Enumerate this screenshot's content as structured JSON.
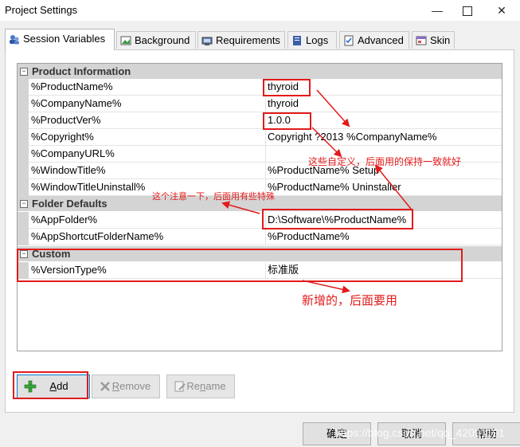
{
  "window": {
    "title": "Project Settings"
  },
  "tabs": [
    {
      "label": "Session Variables",
      "icon": "variables-icon"
    },
    {
      "label": "Background",
      "icon": "background-icon"
    },
    {
      "label": "Requirements",
      "icon": "requirements-icon"
    },
    {
      "label": "Logs",
      "icon": "logs-icon"
    },
    {
      "label": "Advanced",
      "icon": "advanced-icon"
    },
    {
      "label": "Skin",
      "icon": "skin-icon"
    }
  ],
  "grid": {
    "categories": [
      {
        "label": "Product Information",
        "toggle": "−",
        "rows": [
          {
            "name": "%ProductName%",
            "value": "thyroid"
          },
          {
            "name": "%CompanyName%",
            "value": "thyroid"
          },
          {
            "name": "%ProductVer%",
            "value": "1.0.0"
          },
          {
            "name": "%Copyright%",
            "value": "Copyright ?2013 %CompanyName%"
          },
          {
            "name": "%CompanyURL%",
            "value": ""
          },
          {
            "name": "%WindowTitle%",
            "value": "%ProductName% Setup"
          },
          {
            "name": "%WindowTitleUninstall%",
            "value": "%ProductName% Uninstaller"
          }
        ]
      },
      {
        "label": "Folder Defaults",
        "toggle": "−",
        "rows": [
          {
            "name": "%AppFolder%",
            "value": "D:\\Software\\%ProductName%"
          },
          {
            "name": "%AppShortcutFolderName%",
            "value": "%ProductName%"
          }
        ]
      },
      {
        "label": "Custom",
        "toggle": "−",
        "rows": [
          {
            "name": "%VersionType%",
            "value": "标准版"
          }
        ]
      }
    ]
  },
  "actions": {
    "add": {
      "label": "Add",
      "underline": "A",
      "rest": "dd"
    },
    "remove": {
      "label": "Remove",
      "underline": "R",
      "rest": "emove"
    },
    "rename": {
      "label": "Rename",
      "underline": "n",
      "pre": "Re",
      "rest": "ame"
    }
  },
  "footer": {
    "ok": "确定",
    "cancel": "取消",
    "help": "帮助"
  },
  "annotations": {
    "custom_note": "这些自定义，后面用的保持一致就好",
    "folder_note": "这个注意一下，后面用有些特殊",
    "new_note": "新增的，后面要用"
  },
  "watermark": "https://blog.csdn.net/qq_42091191",
  "colors": {
    "annotation": "#e21b1b",
    "category_bg": "#d4d4d4",
    "focus": "#0078d7"
  }
}
